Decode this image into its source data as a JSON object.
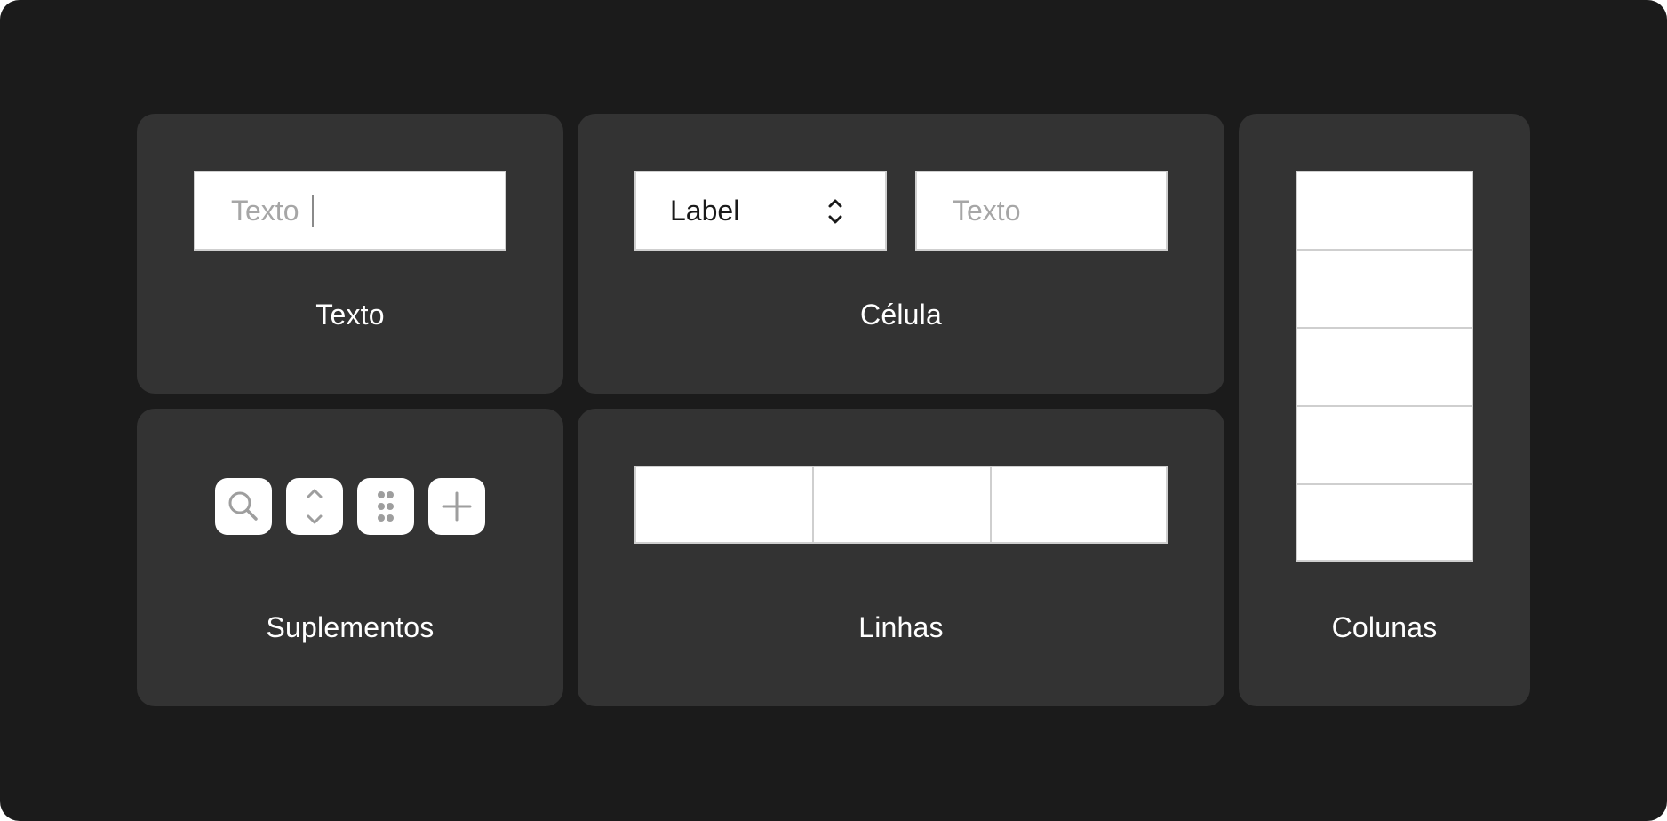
{
  "cards": {
    "texto": {
      "title": "Texto",
      "input_placeholder": "Texto"
    },
    "celula": {
      "title": "Célula",
      "select_value": "Label",
      "input_placeholder": "Texto"
    },
    "colunas": {
      "title": "Colunas",
      "cell_count": 5
    },
    "suplementos": {
      "title": "Suplementos",
      "tools": [
        "search-icon",
        "chevron-up-down-icon",
        "drag-handle-icon",
        "plus-icon"
      ]
    },
    "linhas": {
      "title": "Linhas",
      "cell_count": 3
    }
  },
  "colors": {
    "background": "#1b1b1b",
    "card": "#333333",
    "field": "#ffffff",
    "field_border": "#cfcfcf",
    "placeholder": "#a6a6a6",
    "icon_gray": "#9e9e9e"
  }
}
